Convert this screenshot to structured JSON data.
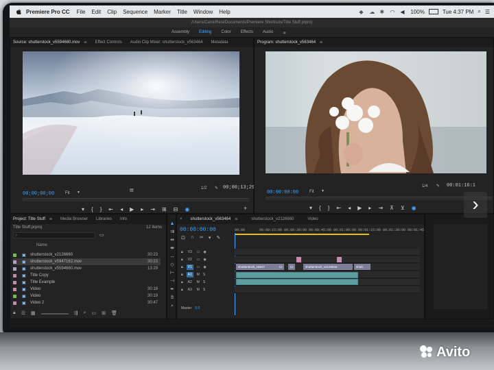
{
  "menubar": {
    "app": "Premiere Pro CC",
    "items": [
      "File",
      "Edit",
      "Clip",
      "Sequence",
      "Marker",
      "Title",
      "Window",
      "Help"
    ],
    "battery": "100%",
    "clock": "Tue 4:37 PM"
  },
  "titlebar": {
    "path": "/Users/Carol/Resi/Documents/Premiere Shortcuts/Title Stuff.prproj"
  },
  "workspaces": {
    "items": [
      "Assembly",
      "Editing",
      "Color",
      "Effects",
      "Audio"
    ],
    "active": "Editing"
  },
  "source": {
    "tabs": [
      "Source: shutterstock_v5594660.mov",
      "Effect Controls",
      "Audio Clip Mixer: shutterstock_v563464",
      "Metadata"
    ],
    "timecode_in": "00;00;00;00",
    "fit": "Fit",
    "scale": "1/2",
    "timecode_dur": "00;00;13;29"
  },
  "program": {
    "tab": "Program: shutterstock_v563464",
    "timecode_in": "00:00:00:00",
    "fit": "Fit",
    "scale": "1/4",
    "timecode_dur": "00:01:16:1"
  },
  "project": {
    "tabs": [
      "Project: Title Stuff",
      "Media Browser",
      "Libraries",
      "Info"
    ],
    "file": "Title Stuff.prproj",
    "count": "12 Items",
    "col_name": "Name",
    "rows": [
      {
        "name": "shutterstock_v2126660",
        "dur": "30:23",
        "color": "#6fbf4f",
        "sel": false
      },
      {
        "name": "shutterstock_v5947162.mov",
        "dur": "30:23",
        "color": "#b99ac9",
        "sel": true
      },
      {
        "name": "shutterstock_v5594660.mov",
        "dur": "13:29",
        "color": "#b99ac9",
        "sel": false
      },
      {
        "name": "Title Copy",
        "dur": "",
        "color": "#c98ab0",
        "sel": false
      },
      {
        "name": "Title Example",
        "dur": "",
        "color": "#c98ab0",
        "sel": false
      },
      {
        "name": "Video",
        "dur": "30:18",
        "color": "#c98ab0",
        "sel": false
      },
      {
        "name": "Video",
        "dur": "30:19",
        "color": "#6fbf4f",
        "sel": false
      },
      {
        "name": "Video 2",
        "dur": "30:47",
        "color": "#c98ab0",
        "sel": false
      }
    ]
  },
  "timeline": {
    "tabs": [
      "shutterstock_v563464",
      "shutterstock_v2126660",
      "Video"
    ],
    "timecode": "00:00:00:00",
    "ticks": [
      "00:00",
      "00:00:15:00",
      "00:00:30:00",
      "00:00:45:00",
      "00:01:00:00",
      "00:01:15:00",
      "00:01:30:00",
      "00:01:45:00"
    ],
    "tracks": [
      "V3",
      "V2",
      "V1",
      "A1",
      "A2",
      "A3"
    ],
    "master": "Master",
    "master_val": "0.0",
    "clips": {
      "c1": "shutterstock_v5647",
      "c2": "Cr",
      "c3": "Cr",
      "c4": "shutterstock_v2126644",
      "c5": "shutt"
    }
  }
}
